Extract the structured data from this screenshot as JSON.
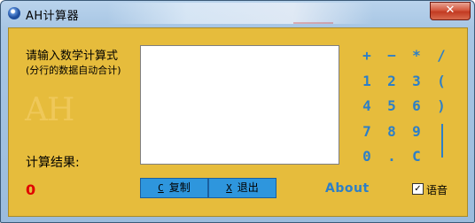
{
  "window": {
    "title": "AH计算器",
    "close_glyph": "✕"
  },
  "input": {
    "prompt": "请输入数学计算式",
    "hint": "(分行的数据自动合计)",
    "value": ""
  },
  "watermark": "AH",
  "result": {
    "label": "计算结果:",
    "value": "0"
  },
  "buttons": {
    "copy_key": "C",
    "copy_label": "复制",
    "exit_key": "X",
    "exit_label": "退出"
  },
  "about_label": "About",
  "voice": {
    "checked": true,
    "check_glyph": "✓",
    "label": "语音"
  },
  "keypad": {
    "row1": [
      "+",
      "−",
      "*",
      "/"
    ],
    "row2": [
      "1",
      "2",
      "3",
      "("
    ],
    "row3": [
      "4",
      "5",
      "6",
      ")"
    ],
    "row4": [
      "7",
      "8",
      "9"
    ],
    "row5": [
      "0",
      ".",
      "C"
    ]
  },
  "colors": {
    "panel": "#e6bc3c",
    "accent": "#2d7fc7",
    "result": "#e00000",
    "button": "#2e96dd"
  }
}
